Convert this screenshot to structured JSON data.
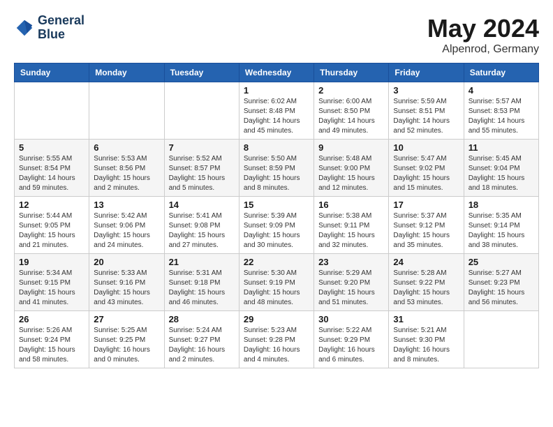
{
  "header": {
    "logo_line1": "General",
    "logo_line2": "Blue",
    "month": "May 2024",
    "location": "Alpenrod, Germany"
  },
  "weekdays": [
    "Sunday",
    "Monday",
    "Tuesday",
    "Wednesday",
    "Thursday",
    "Friday",
    "Saturday"
  ],
  "weeks": [
    [
      {
        "day": "",
        "info": ""
      },
      {
        "day": "",
        "info": ""
      },
      {
        "day": "",
        "info": ""
      },
      {
        "day": "1",
        "info": "Sunrise: 6:02 AM\nSunset: 8:48 PM\nDaylight: 14 hours\nand 45 minutes."
      },
      {
        "day": "2",
        "info": "Sunrise: 6:00 AM\nSunset: 8:50 PM\nDaylight: 14 hours\nand 49 minutes."
      },
      {
        "day": "3",
        "info": "Sunrise: 5:59 AM\nSunset: 8:51 PM\nDaylight: 14 hours\nand 52 minutes."
      },
      {
        "day": "4",
        "info": "Sunrise: 5:57 AM\nSunset: 8:53 PM\nDaylight: 14 hours\nand 55 minutes."
      }
    ],
    [
      {
        "day": "5",
        "info": "Sunrise: 5:55 AM\nSunset: 8:54 PM\nDaylight: 14 hours\nand 59 minutes."
      },
      {
        "day": "6",
        "info": "Sunrise: 5:53 AM\nSunset: 8:56 PM\nDaylight: 15 hours\nand 2 minutes."
      },
      {
        "day": "7",
        "info": "Sunrise: 5:52 AM\nSunset: 8:57 PM\nDaylight: 15 hours\nand 5 minutes."
      },
      {
        "day": "8",
        "info": "Sunrise: 5:50 AM\nSunset: 8:59 PM\nDaylight: 15 hours\nand 8 minutes."
      },
      {
        "day": "9",
        "info": "Sunrise: 5:48 AM\nSunset: 9:00 PM\nDaylight: 15 hours\nand 12 minutes."
      },
      {
        "day": "10",
        "info": "Sunrise: 5:47 AM\nSunset: 9:02 PM\nDaylight: 15 hours\nand 15 minutes."
      },
      {
        "day": "11",
        "info": "Sunrise: 5:45 AM\nSunset: 9:04 PM\nDaylight: 15 hours\nand 18 minutes."
      }
    ],
    [
      {
        "day": "12",
        "info": "Sunrise: 5:44 AM\nSunset: 9:05 PM\nDaylight: 15 hours\nand 21 minutes."
      },
      {
        "day": "13",
        "info": "Sunrise: 5:42 AM\nSunset: 9:06 PM\nDaylight: 15 hours\nand 24 minutes."
      },
      {
        "day": "14",
        "info": "Sunrise: 5:41 AM\nSunset: 9:08 PM\nDaylight: 15 hours\nand 27 minutes."
      },
      {
        "day": "15",
        "info": "Sunrise: 5:39 AM\nSunset: 9:09 PM\nDaylight: 15 hours\nand 30 minutes."
      },
      {
        "day": "16",
        "info": "Sunrise: 5:38 AM\nSunset: 9:11 PM\nDaylight: 15 hours\nand 32 minutes."
      },
      {
        "day": "17",
        "info": "Sunrise: 5:37 AM\nSunset: 9:12 PM\nDaylight: 15 hours\nand 35 minutes."
      },
      {
        "day": "18",
        "info": "Sunrise: 5:35 AM\nSunset: 9:14 PM\nDaylight: 15 hours\nand 38 minutes."
      }
    ],
    [
      {
        "day": "19",
        "info": "Sunrise: 5:34 AM\nSunset: 9:15 PM\nDaylight: 15 hours\nand 41 minutes."
      },
      {
        "day": "20",
        "info": "Sunrise: 5:33 AM\nSunset: 9:16 PM\nDaylight: 15 hours\nand 43 minutes."
      },
      {
        "day": "21",
        "info": "Sunrise: 5:31 AM\nSunset: 9:18 PM\nDaylight: 15 hours\nand 46 minutes."
      },
      {
        "day": "22",
        "info": "Sunrise: 5:30 AM\nSunset: 9:19 PM\nDaylight: 15 hours\nand 48 minutes."
      },
      {
        "day": "23",
        "info": "Sunrise: 5:29 AM\nSunset: 9:20 PM\nDaylight: 15 hours\nand 51 minutes."
      },
      {
        "day": "24",
        "info": "Sunrise: 5:28 AM\nSunset: 9:22 PM\nDaylight: 15 hours\nand 53 minutes."
      },
      {
        "day": "25",
        "info": "Sunrise: 5:27 AM\nSunset: 9:23 PM\nDaylight: 15 hours\nand 56 minutes."
      }
    ],
    [
      {
        "day": "26",
        "info": "Sunrise: 5:26 AM\nSunset: 9:24 PM\nDaylight: 15 hours\nand 58 minutes."
      },
      {
        "day": "27",
        "info": "Sunrise: 5:25 AM\nSunset: 9:25 PM\nDaylight: 16 hours\nand 0 minutes."
      },
      {
        "day": "28",
        "info": "Sunrise: 5:24 AM\nSunset: 9:27 PM\nDaylight: 16 hours\nand 2 minutes."
      },
      {
        "day": "29",
        "info": "Sunrise: 5:23 AM\nSunset: 9:28 PM\nDaylight: 16 hours\nand 4 minutes."
      },
      {
        "day": "30",
        "info": "Sunrise: 5:22 AM\nSunset: 9:29 PM\nDaylight: 16 hours\nand 6 minutes."
      },
      {
        "day": "31",
        "info": "Sunrise: 5:21 AM\nSunset: 9:30 PM\nDaylight: 16 hours\nand 8 minutes."
      },
      {
        "day": "",
        "info": ""
      }
    ]
  ]
}
